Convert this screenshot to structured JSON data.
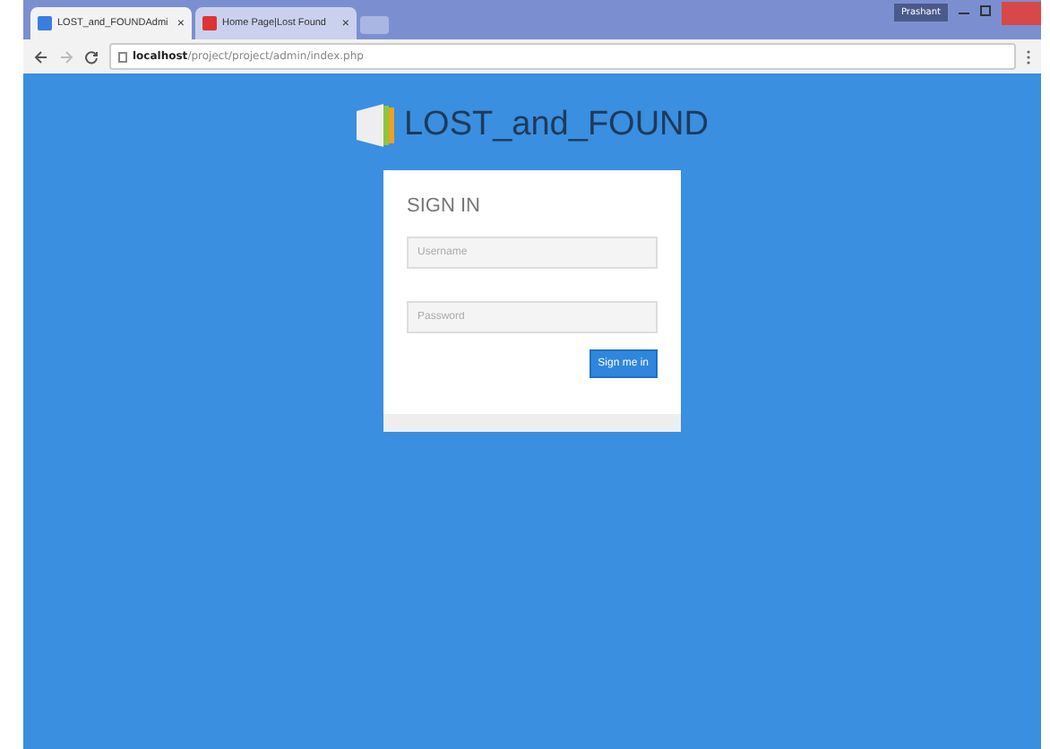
{
  "browser": {
    "tabs": [
      {
        "label": "LOST_and_FOUNDAdmi",
        "close": "×",
        "selected": true
      },
      {
        "label": "Home Page|Lost Found",
        "close": "×",
        "selected": false
      }
    ],
    "profile": "Prashant",
    "address": {
      "host": "localhost",
      "path": "/project/project/admin/index.php"
    }
  },
  "logo": {
    "text": "LOST_and_FOUND"
  },
  "signin": {
    "title": "SIGN IN",
    "username": {
      "placeholder": "Username"
    },
    "password": {
      "placeholder": "Password"
    },
    "button": "Sign me in"
  }
}
